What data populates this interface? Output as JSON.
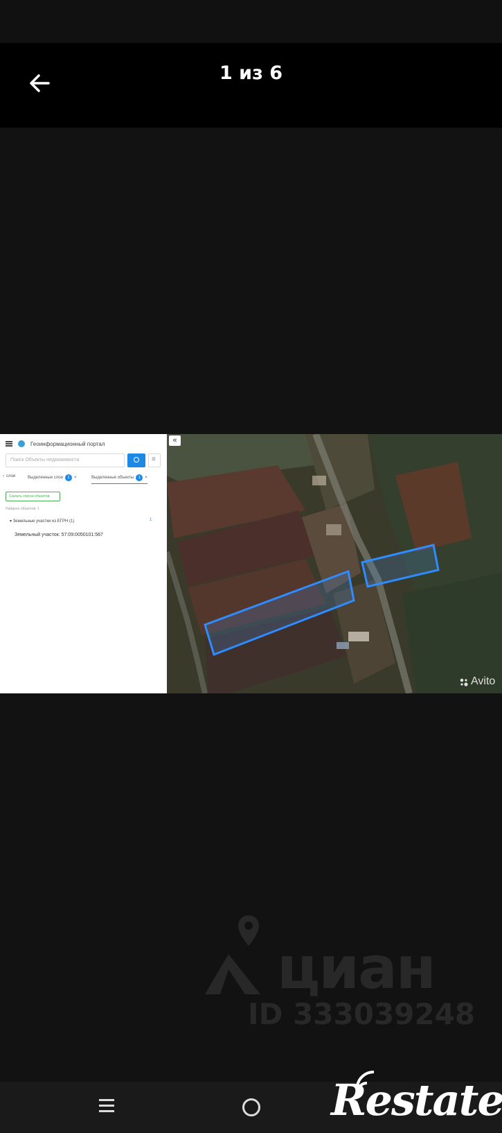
{
  "header": {
    "counter": "1 из 6",
    "back_icon": "arrow-left-icon"
  },
  "photo": {
    "portal": {
      "title": "Геоинформационный портал",
      "search_placeholder": "Поиск Объекты недвижимости",
      "tabs": [
        {
          "label": "слои",
          "badge": ""
        },
        {
          "label": "Выделенные слои",
          "badge": "1"
        },
        {
          "label": "Выделенные объекты",
          "badge": "1"
        }
      ],
      "export_label": "Скачать список объектов",
      "found_label": "Найдено объектов: 1",
      "group_label": "Земельные участки из ЕГРН (1)",
      "group_count": "1",
      "parcel_label": "Земельный участок: 57:09:0050101:567"
    },
    "map": {
      "collapse_label": "«",
      "highlight_color": "#2f8cff"
    },
    "avito_watermark": "Avito"
  },
  "watermarks": {
    "cian_text": "циан",
    "cian_id": "ID 333039248",
    "restate_logo": "Restate"
  },
  "navigation": {
    "menu_icon": "recent-apps-icon",
    "home_icon": "home-icon"
  }
}
